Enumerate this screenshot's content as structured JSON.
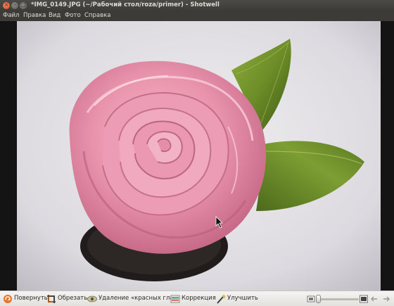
{
  "window": {
    "title": "*IMG_0149.JPG (~/Рабочий стол/roza/primer) - Shotwell"
  },
  "menubar": {
    "items": [
      "Файл",
      "Правка",
      "Вид",
      "Фото",
      "Справка"
    ]
  },
  "viewer": {
    "image_icon": "photo-of-pink-satin-ribbon-rose-with-green-leaves"
  },
  "toolbar": {
    "rotate_label": "Повернуть",
    "crop_label": "Обрезать",
    "redeye_label": "Удаление «красных глаз»",
    "adjust_label": "Коррекция",
    "enhance_label": "Улучшить",
    "zoom_level": 0.0
  },
  "colors": {
    "titlebar": "#3c3b37",
    "close_button": "#e0582b",
    "toolbar_bg": "#efeeed",
    "rose_pink": "#e98aa6",
    "leaf_green": "#6b8f2a"
  },
  "icons": {
    "rotate": "rotate-icon",
    "crop": "crop-icon",
    "redeye": "redeye-icon",
    "adjust": "adjust-icon",
    "enhance": "enhance-icon",
    "zoom_out": "zoom-out-icon",
    "zoom_in": "zoom-in-icon",
    "prev": "previous-arrow-icon",
    "next": "next-arrow-icon"
  }
}
